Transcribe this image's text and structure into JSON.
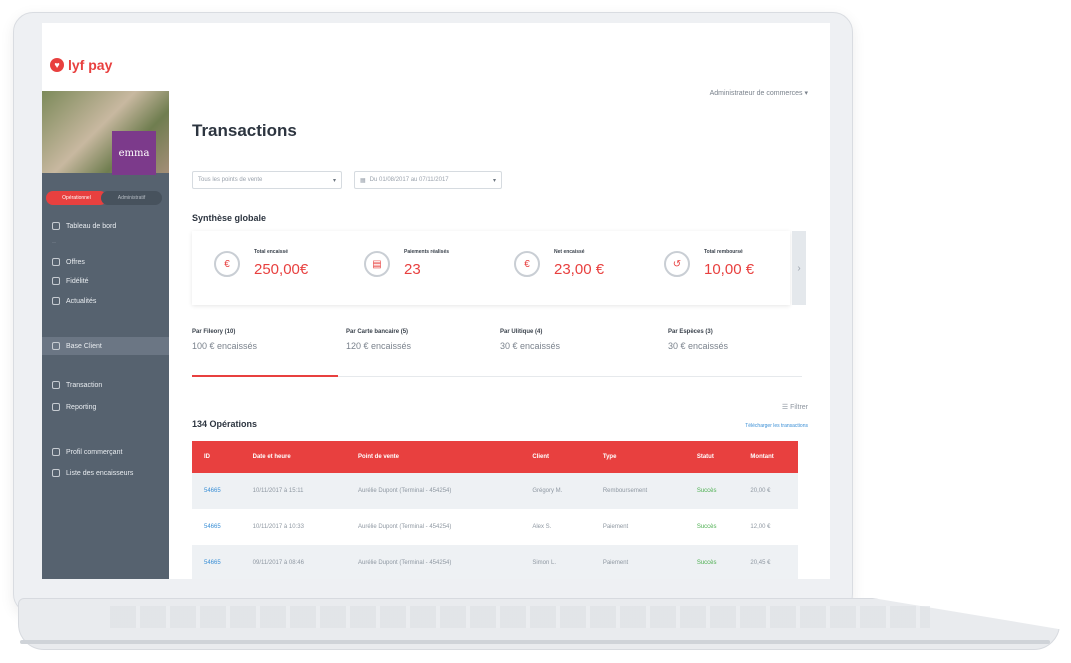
{
  "app": {
    "logo_text": "lyf pay",
    "user_menu": "Administrateur de commerces ▾",
    "brand_tile": "emma",
    "accent": "#e8403f"
  },
  "sidebar": {
    "segment": [
      "Opérationnel",
      "Administratif"
    ],
    "items": [
      {
        "label": "Tableau de bord",
        "icon": "dashboard-icon"
      },
      {
        "label": "Offres",
        "icon": "tag-icon"
      },
      {
        "label": "Fidélité",
        "icon": "gift-icon"
      },
      {
        "label": "Actualités",
        "icon": "news-icon"
      },
      {
        "label": "Base Client",
        "icon": "user-icon"
      },
      {
        "label": "Transaction",
        "icon": "card-icon"
      },
      {
        "label": "Reporting",
        "icon": "report-icon"
      },
      {
        "label": "Profil commerçant",
        "icon": "store-icon"
      },
      {
        "label": "Liste des encaisseurs",
        "icon": "list-icon"
      }
    ]
  },
  "main": {
    "title": "Transactions",
    "select_point": "Tous les points de vente",
    "select_period": "Du 01/08/2017 au 07/11/2017",
    "section": "Synthèse globale",
    "kpis": [
      {
        "label": "Total encaissé",
        "value": "250,00€"
      },
      {
        "label": "Paiements réalisés",
        "value": "23"
      },
      {
        "label": "Net encaissé",
        "value": "23,00 €"
      },
      {
        "label": "Total remboursé",
        "value": "10,00 €"
      }
    ],
    "tabs": [
      {
        "label": "Par Fileory (10)",
        "value": "100 € encaissés"
      },
      {
        "label": "Par Carte bancaire (5)",
        "value": "120 € encaissés"
      },
      {
        "label": "Par Ulitique (4)",
        "value": "30 € encaissés"
      },
      {
        "label": "Par Espèces (3)",
        "value": "30 € encaissés"
      }
    ],
    "filter": "Filtrer",
    "ops_count": "134 Opérations",
    "export": "Télécharger les transactions",
    "table": {
      "headers": [
        "ID",
        "Date et heure",
        "Point de vente",
        "Client",
        "Type",
        "Statut",
        "Montant"
      ],
      "rows": [
        [
          "54665",
          "10/11/2017 à 15:11",
          "Aurélie Dupont (Terminal - 454254)",
          "Grégory M.",
          "Remboursement",
          "Succès",
          "20,00 €"
        ],
        [
          "54665",
          "10/11/2017 à 10:33",
          "Aurélie Dupont (Terminal - 454254)",
          "Alex S.",
          "Paiement",
          "Succès",
          "12,00 €"
        ],
        [
          "54665",
          "09/11/2017 à 08:46",
          "Aurélie Dupont (Terminal - 454254)",
          "Simon L.",
          "Paiement",
          "Succès",
          "20,45 €"
        ]
      ]
    }
  }
}
